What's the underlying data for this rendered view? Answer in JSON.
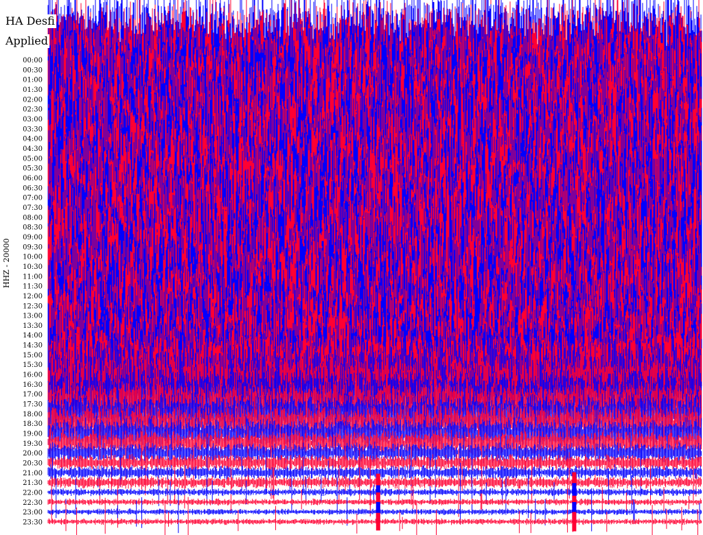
{
  "header": {
    "title": "HA Desfi",
    "subtitle": "Applied"
  },
  "colors": {
    "trace_a": "#ff0033",
    "trace_b": "#0000ff",
    "background": "#ffffff",
    "text": "#000000"
  },
  "chart_data": {
    "type": "line",
    "subtype": "helicorder",
    "ylabel": "HHZ - 20000",
    "row_labels": [
      "00:00",
      "00:30",
      "01:00",
      "01:30",
      "02:00",
      "02:30",
      "03:00",
      "03:30",
      "04:00",
      "04:30",
      "05:00",
      "05:30",
      "06:00",
      "06:30",
      "07:00",
      "07:30",
      "08:00",
      "08:30",
      "09:00",
      "09:30",
      "10:00",
      "10:30",
      "11:00",
      "11:30",
      "12:00",
      "12:30",
      "13:00",
      "13:30",
      "14:00",
      "14:30",
      "15:00",
      "15:30",
      "16:00",
      "16:30",
      "17:00",
      "17:30",
      "18:00",
      "18:30",
      "19:00",
      "19:30",
      "20:00",
      "20:30",
      "21:00",
      "21:30",
      "22:00",
      "22:30",
      "23:00",
      "23:30"
    ],
    "row_color_cycle": [
      "#0000ff",
      "#ff0033"
    ],
    "relative_amplitude": [
      1.0,
      1.0,
      1.0,
      1.0,
      1.0,
      1.0,
      1.0,
      1.0,
      1.0,
      1.0,
      1.0,
      1.0,
      1.0,
      1.0,
      1.0,
      1.0,
      1.0,
      1.0,
      1.0,
      1.0,
      1.0,
      1.0,
      1.0,
      1.0,
      1.0,
      1.0,
      0.95,
      0.9,
      0.85,
      0.8,
      0.72,
      0.65,
      0.58,
      0.5,
      0.42,
      0.36,
      0.3,
      0.26,
      0.22,
      0.18,
      0.14,
      0.11,
      0.09,
      0.08,
      0.05,
      0.045,
      0.04,
      0.04
    ],
    "event_markers": [
      {
        "row": "21:30",
        "x_fraction": 0.505
      },
      {
        "row": "21:30",
        "x_fraction": 0.805
      }
    ],
    "legend": "none",
    "grid": false
  }
}
